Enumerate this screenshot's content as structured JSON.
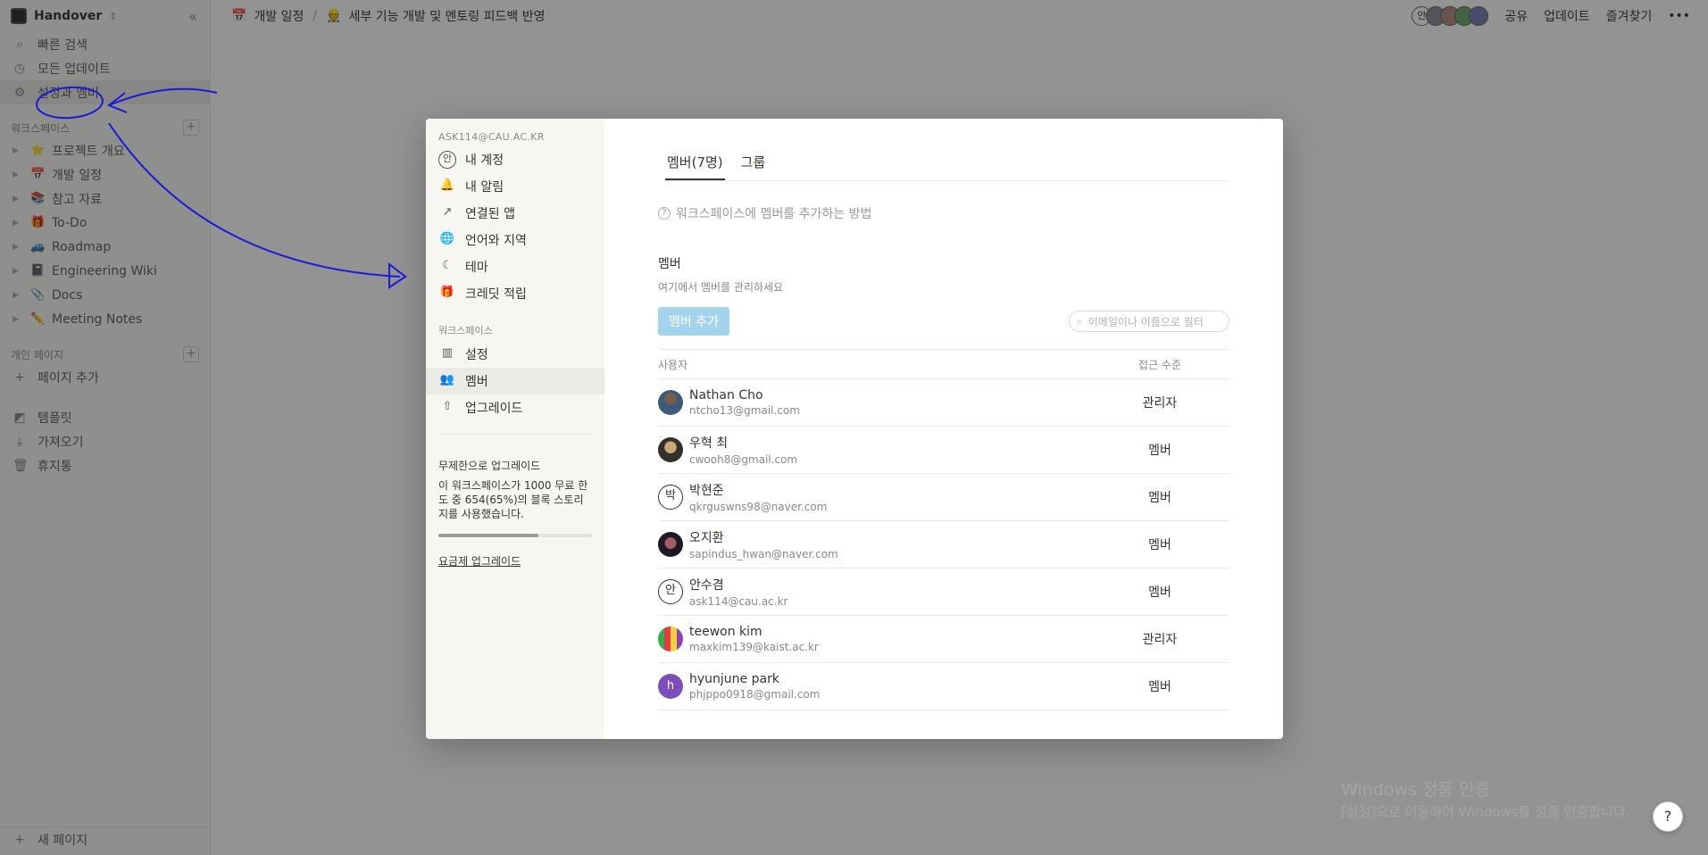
{
  "sidebar": {
    "workspace_name": "Handover",
    "quick_items": [
      {
        "label": "빠른 검색",
        "icon": "search-icon"
      },
      {
        "label": "모든 업데이트",
        "icon": "clock-icon"
      },
      {
        "label": "설정과 멤버",
        "icon": "gear-icon"
      }
    ],
    "workspace_section": "워크스페이스",
    "pages": [
      {
        "label": "프로젝트 개요",
        "emoji": "⭐"
      },
      {
        "label": "개발 일정",
        "emoji": "📅"
      },
      {
        "label": "참고 자료",
        "emoji": "📚"
      },
      {
        "label": "To-Do",
        "emoji": "🎁"
      },
      {
        "label": "Roadmap",
        "emoji": "🚙"
      },
      {
        "label": "Engineering Wiki",
        "emoji": "📓"
      },
      {
        "label": "Docs",
        "emoji": "📎"
      },
      {
        "label": "Meeting Notes",
        "emoji": "✏️"
      }
    ],
    "private_section": "개인 페이지",
    "add_page": "페이지 추가",
    "tools": [
      {
        "label": "템플릿",
        "icon": "shapes-icon"
      },
      {
        "label": "가져오기",
        "icon": "download-icon"
      },
      {
        "label": "휴지통",
        "icon": "trash-icon"
      }
    ],
    "new_page": "새 페이지"
  },
  "topbar": {
    "breadcrumb_1": "개발 일정",
    "breadcrumb_1_emoji": "📅",
    "breadcrumb_2": "세부 기능 개발 및 멘토링 피드백 반영",
    "breadcrumb_2_emoji": "👷",
    "avatar_initial": "안",
    "share": "공유",
    "updates": "업데이트",
    "favorite": "즐겨찾기",
    "more": "•••"
  },
  "modal": {
    "account_email": "ASK114@CAU.AC.KR",
    "account_items": [
      {
        "label": "내 계정",
        "icon": "account-avatar-icon",
        "glyph": "안"
      },
      {
        "label": "내 알림",
        "icon": "bell-icon",
        "glyph": "🔔"
      },
      {
        "label": "연결된 앱",
        "icon": "external-link-icon",
        "glyph": "↗"
      },
      {
        "label": "언어와 지역",
        "icon": "globe-icon",
        "glyph": "🌐"
      },
      {
        "label": "테마",
        "icon": "moon-icon",
        "glyph": "☾"
      },
      {
        "label": "크레딧 적립",
        "icon": "gift-icon",
        "glyph": "🎁"
      }
    ],
    "workspace_section": "워크스페이스",
    "workspace_items": [
      {
        "label": "설정",
        "icon": "building-icon",
        "glyph": "▥"
      },
      {
        "label": "멤버",
        "icon": "members-icon",
        "glyph": "👥"
      },
      {
        "label": "업그레이드",
        "icon": "upgrade-icon",
        "glyph": "⇧"
      }
    ],
    "upgrade_title": "무제한으로 업그레이드",
    "upgrade_desc": "이 워크스페이스가 1000 무료 한도 중 654(65%)의 블록 스토리지를 사용했습니다.",
    "usage_fraction": 0.654,
    "plan_link": "요금제 업그레이드",
    "tabs": [
      "멤버(7명)",
      "그룹"
    ],
    "help_text": "워크스페이스에 멤버를 추가하는 방법",
    "members_title": "멤버",
    "members_subtitle": "여기에서 멤버를 관리하세요",
    "add_member_button": "멤버 추가",
    "filter_placeholder": "이메일이나 이름으로 필터",
    "col_user": "사용자",
    "col_access": "접근 수준",
    "members": [
      {
        "name": "Nathan Cho",
        "email": "ntcho13@gmail.com",
        "role": "관리자",
        "avatar": "photo1",
        "initial": ""
      },
      {
        "name": "우혁 최",
        "email": "cwooh8@gmail.com",
        "role": "멤버",
        "avatar": "photo2",
        "initial": ""
      },
      {
        "name": "박현준",
        "email": "qkrguswns98@naver.com",
        "role": "멤버",
        "avatar": "outline",
        "initial": "박"
      },
      {
        "name": "오지환",
        "email": "sapindus_hwan@naver.com",
        "role": "멤버",
        "avatar": "photo3",
        "initial": ""
      },
      {
        "name": "안수겸",
        "email": "ask114@cau.ac.kr",
        "role": "멤버",
        "avatar": "outline",
        "initial": "안"
      },
      {
        "name": "teewon kim",
        "email": "maxkim139@kaist.ac.kr",
        "role": "관리자",
        "avatar": "stripes",
        "initial": ""
      },
      {
        "name": "hyunjune park",
        "email": "phjppo0918@gmail.com",
        "role": "멤버",
        "avatar": "purple",
        "initial": "h"
      }
    ]
  },
  "watermark": {
    "title": "Windows 정품 인증",
    "subtitle": "[설정]으로 이동하여 Windows를 정품 인증합니다."
  },
  "help_fab": "?",
  "colors": {
    "add_button": "#a4d3ee",
    "annotation": "#1a1ad9",
    "avatar_purple": "#7c4dbc"
  }
}
